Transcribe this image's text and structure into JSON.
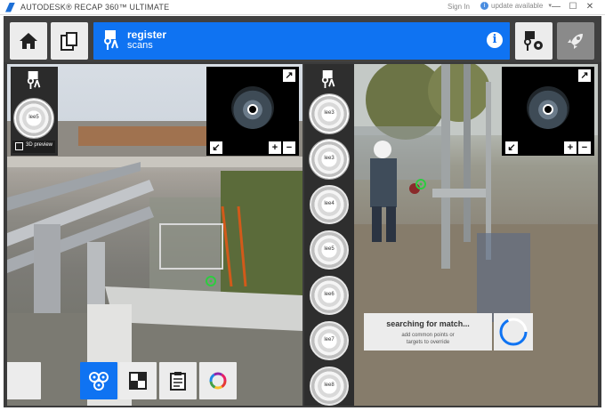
{
  "window": {
    "title": "AUTODESK® RECAP 360™ ULTIMATE",
    "sign_in": "Sign In",
    "update": "update available",
    "update_icon": "i",
    "controls": {
      "minimize": "—",
      "maximize": "☐",
      "close": "✕"
    }
  },
  "banner": {
    "title": "register",
    "subtitle": "scans",
    "info_icon": "i"
  },
  "left_pane": {
    "preview_label": "3D preview",
    "thumb_label": "lee5"
  },
  "scan_strip": {
    "items": [
      "lee3",
      "lee3",
      "lee4",
      "lee5",
      "lee6",
      "lee7",
      "lee8"
    ]
  },
  "minimap": {
    "zoom_in": "+",
    "zoom_out": "−"
  },
  "match_panel": {
    "title": "searching for match...",
    "hint_line1": "add common points or",
    "hint_line2": "targets to override"
  },
  "colors": {
    "accent": "#0f73f2",
    "target_green": "#2ecc40",
    "toolbar_bg": "#ececec"
  }
}
